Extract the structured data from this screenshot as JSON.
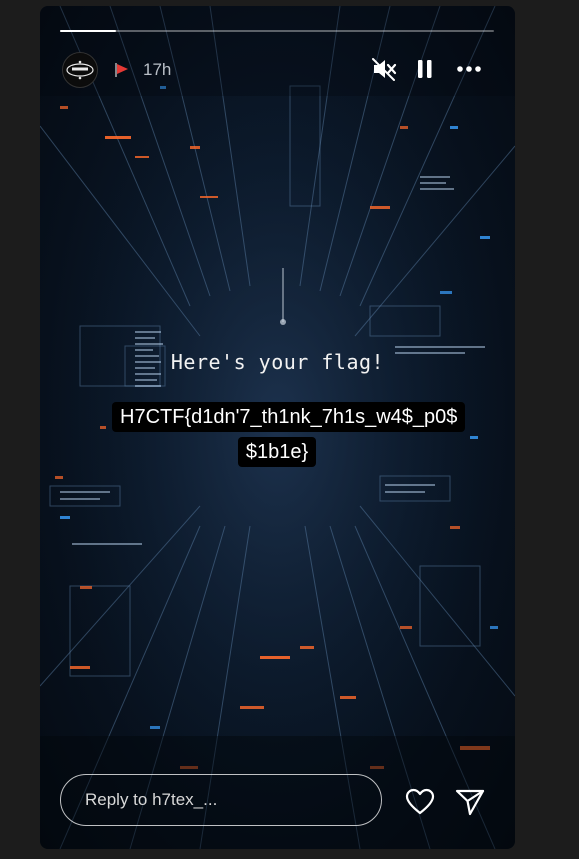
{
  "story": {
    "progress": 0.13,
    "header": {
      "avatar_alt": "h7tex",
      "time": "17h"
    },
    "caption": "Here's your flag!",
    "flag": "H7CTF{d1dn'7_th1nk_7h1s_w4$_p0$ $1b1e}",
    "reply": {
      "placeholder": "Reply to h7tex_..."
    }
  },
  "icons": {
    "flag": "red-flag-icon",
    "mute": "speaker-muted-icon",
    "pause": "pause-icon",
    "more": "more-horizontal-icon",
    "like": "heart-icon",
    "share": "send-icon"
  },
  "colors": {
    "page_bg": "#1c1c1c",
    "text": "#ffffff",
    "flag_red": "#e53935",
    "accent_orange": "#ff6a2b",
    "accent_blue": "#3aa0ff"
  }
}
